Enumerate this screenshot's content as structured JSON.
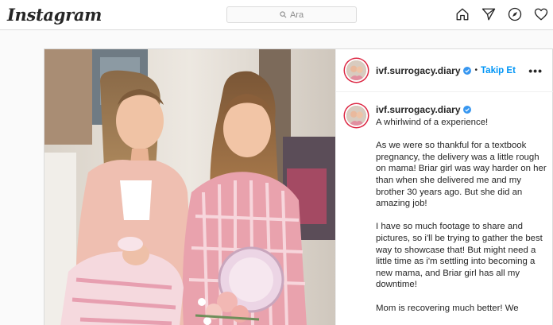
{
  "nav": {
    "logo": "Instagram",
    "search_placeholder": "Ara",
    "icons": [
      "home-icon",
      "direct-icon",
      "explore-icon",
      "activity-icon"
    ]
  },
  "post": {
    "username": "ivf.surrogacy.diary",
    "dot": "•",
    "follow_label": "Takip Et",
    "more_label": "•••",
    "photo_description_icon": "post-photo",
    "caption": {
      "username": "ivf.surrogacy.diary",
      "paragraphs": [
        "A whirlwind of a experience!",
        "As we were so thankful for a textbook pregnancy, the delivery was a little rough on mama! Briar girl was way harder on her than when she delivered me and my brother 30 years ago. But she did an amazing job!",
        "I have so much footage to share and pictures, so i'll be trying to gather the best way to showcase that! But might need a little time as i'm settling into becoming a new mama, and Briar girl has all my downtime!",
        "Mom is recovering much better! We"
      ]
    }
  },
  "colors": {
    "link_blue": "#0095f6",
    "border": "#dbdbdb",
    "background": "#fafafa",
    "verified_blue": "#3897f0"
  }
}
